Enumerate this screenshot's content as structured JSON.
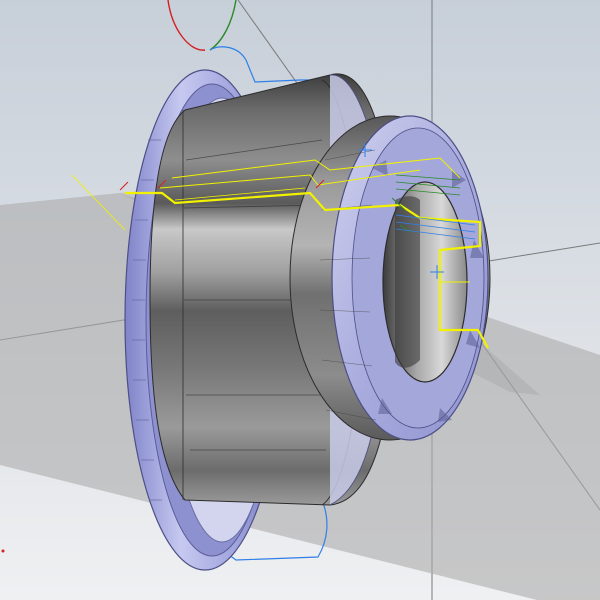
{
  "viewport": {
    "background_top": "#c9d1da",
    "background_bottom": "#eceef1",
    "section_plane_color": "#adadad",
    "sketch_color": "#f2f200",
    "wcs_x_color": "#2a8a2a",
    "wcs_y_color": "#d42020",
    "toolpath_color": "#2f7fe8",
    "part_rim_color": "#9c9fd8",
    "part_body_color": "#5c5c5c",
    "part_groove_color": "#d7d9ec",
    "construction_line_color": "#7a7a7a"
  },
  "model": {
    "kind": "flanged-bushing-body"
  }
}
